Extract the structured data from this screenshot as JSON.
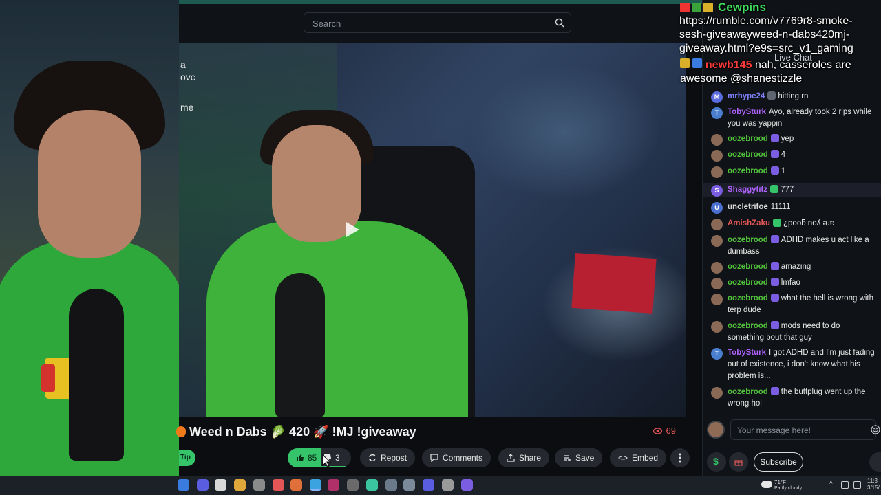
{
  "search": {
    "placeholder": "Search"
  },
  "video": {
    "side_texts": [
      "a",
      "ovc",
      "me"
    ]
  },
  "stream": {
    "title": "Weed n Dabs 🥬 420 🚀 !MJ !giveaway",
    "views": "69"
  },
  "actions": {
    "tip_label": "Tip",
    "likes": "85",
    "dislikes": "3",
    "repost_label": "Repost",
    "comments_label": "Comments",
    "share_label": "Share",
    "save_label": "Save",
    "embed_label": "Embed"
  },
  "overlay": {
    "user1": "Cewpins",
    "url": "https://rumble.com/v7769r8-smoke-sesh-giveawayweed-n-dabs420mj-giveaway.html?e9s=src_v1_gaming",
    "user2": "newb145",
    "msg2": "nah, casseroles are awesome @shanestizzle"
  },
  "chat": {
    "header": "Live Chat",
    "messages": [
      {
        "user": "mrhype24",
        "avatar": "M",
        "text": "hitting rn",
        "color": "#7c7ff5"
      },
      {
        "user": "TobySturk",
        "avatar": "T",
        "text": "Ayo, already took 2 rips while you was yappin",
        "color": "#b063ff"
      },
      {
        "user": "oozebrood",
        "avatar": "",
        "text": "yep",
        "color": "#52c43c"
      },
      {
        "user": "oozebrood",
        "avatar": "",
        "text": "4",
        "color": "#52c43c"
      },
      {
        "user": "oozebrood",
        "avatar": "",
        "text": "1",
        "color": "#52c43c"
      },
      {
        "user": "Shaggytitz",
        "avatar": "S",
        "text": "777",
        "color": "#b063ff"
      },
      {
        "user": "uncletrifoe",
        "avatar": "U",
        "text": "11111",
        "color": "#d8d8d8"
      },
      {
        "user": "AmishZaku",
        "avatar": "",
        "text": "¿pooƃ noʎ ǝɹɐ",
        "color": "#e25656"
      },
      {
        "user": "oozebrood",
        "avatar": "",
        "text": "ADHD makes u act like a dumbass",
        "color": "#52c43c"
      },
      {
        "user": "oozebrood",
        "avatar": "",
        "text": "amazing",
        "color": "#52c43c"
      },
      {
        "user": "oozebrood",
        "avatar": "",
        "text": "lmfao",
        "color": "#52c43c"
      },
      {
        "user": "oozebrood",
        "avatar": "",
        "text": "what the hell is wrong with terp dude",
        "color": "#52c43c"
      },
      {
        "user": "oozebrood",
        "avatar": "",
        "text": "mods need to do something bout that guy",
        "color": "#52c43c"
      },
      {
        "user": "TobySturk",
        "avatar": "T",
        "text": "I got ADHD and I'm just fading out of existence, i don't know what his problem is...",
        "color": "#b063ff"
      },
      {
        "user": "oozebrood",
        "avatar": "",
        "text": "the buttplug went up the wrong hol",
        "color": "#52c43c"
      }
    ],
    "input_placeholder": "Your message here!",
    "subscribe_label": "Subscribe"
  },
  "taskbar": {
    "temp": "71°F",
    "condition": "Partly cloudy",
    "time": "11:3",
    "date": "3/15/"
  },
  "colors": {
    "accent_green": "#35c46a",
    "background": "#0f1216",
    "pill": "#25292f"
  }
}
